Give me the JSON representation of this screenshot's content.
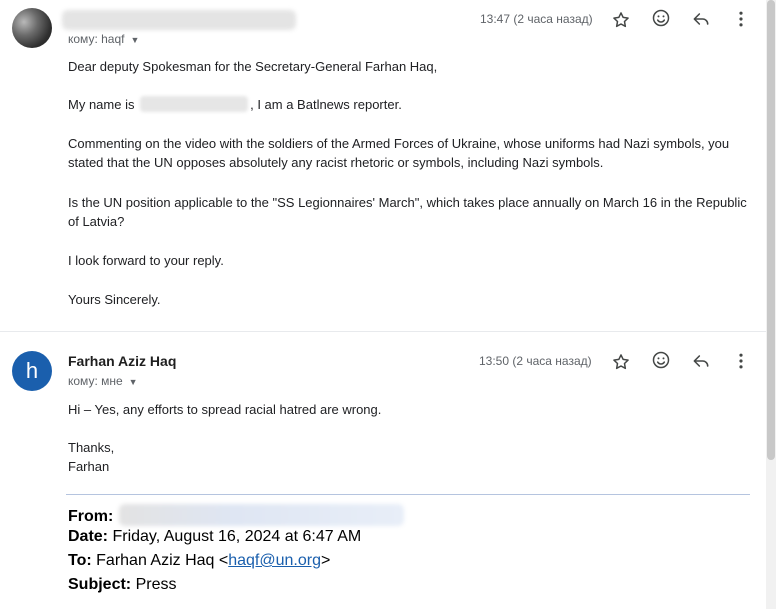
{
  "message1": {
    "to_label": "кому: haqf",
    "time": "13:47 (2 часа назад)",
    "greeting": "Dear deputy Spokesman for the Secretary-General Farhan Haq,",
    "intro_before": "My name is",
    "intro_after": ", I am a Batlnews reporter.",
    "para1": "Commenting on the video with the soldiers of the Armed Forces of Ukraine, whose uniforms had Nazi symbols, you stated that the UN opposes absolutely any racist rhetoric or symbols, including Nazi symbols.",
    "para2": "Is the UN position applicable to the \"SS Legionnaires' March\", which takes place annually on March 16 in the Republic of Latvia?",
    "closing1": "I look forward to your reply.",
    "signoff": "Yours Sincerely."
  },
  "message2": {
    "avatar_letter": "h",
    "sender": "Farhan Aziz Haq",
    "to_label": "кому: мне",
    "time": "13:50 (2 часа назад)",
    "line1": "Hi – Yes, any efforts to spread racial hatred are wrong.",
    "thanks": "Thanks,",
    "name": "Farhan"
  },
  "quoted": {
    "from_label": "From:",
    "date_label": "Date:",
    "date_value": "Friday, August 16, 2024 at 6:47 AM",
    "to_label": "To:",
    "to_name": "Farhan Aziz Haq <",
    "to_email": "haqf@un.org",
    "to_close": ">",
    "subject_label": "Subject:",
    "subject_value": "Press"
  },
  "icons": [
    "star-icon",
    "emoji-icon",
    "reply-icon",
    "more-vert-icon"
  ],
  "colors": {
    "avatar_blue": "#1a5fad",
    "link": "#1a5fad",
    "meta_gray": "#5f6368"
  }
}
